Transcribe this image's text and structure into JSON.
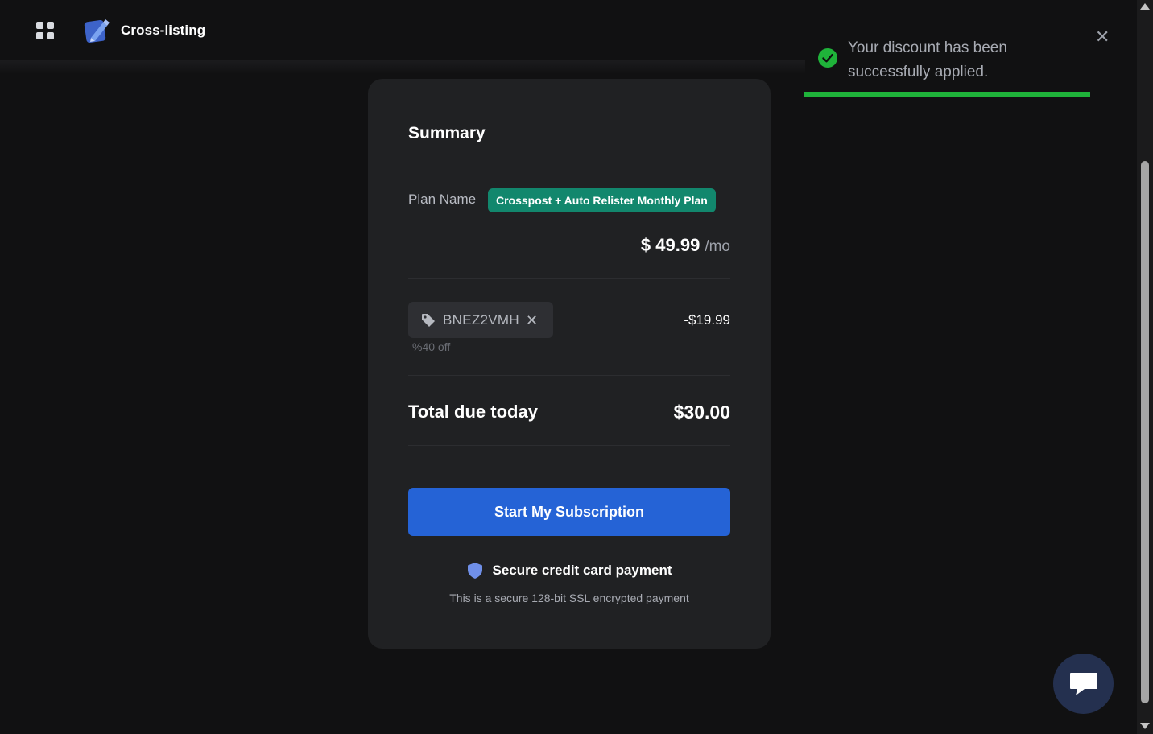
{
  "header": {
    "brand_title": "Cross-listing",
    "apps_icon": "grid-icon",
    "logo_icon": "pencil-logo-icon"
  },
  "summary": {
    "title": "Summary",
    "plan_label": "Plan Name",
    "plan_name": "Crosspost + Auto Relister Monthly Plan",
    "price": "$ 49.99",
    "price_unit": "/mo",
    "coupon_code": "BNEZ2VMH",
    "coupon_remove": "✕",
    "coupon_note": "%40 off",
    "discount_amount": "-$19.99",
    "total_label": "Total due today",
    "total_amount": "$30.00",
    "cta_label": "Start My Subscription",
    "secure_title": "Secure credit card payment",
    "secure_subtitle": "This is a secure 128-bit SSL encrypted payment"
  },
  "toast": {
    "message": "Your discount has been successfully applied.",
    "close": "✕",
    "status": "success",
    "progress_percent": 100
  },
  "chat": {
    "icon": "chat-bubble-icon"
  },
  "colors": {
    "background": "#111112",
    "card": "#202123",
    "badge": "#12876d",
    "primary": "#2563d6",
    "success": "#1fb33a"
  }
}
